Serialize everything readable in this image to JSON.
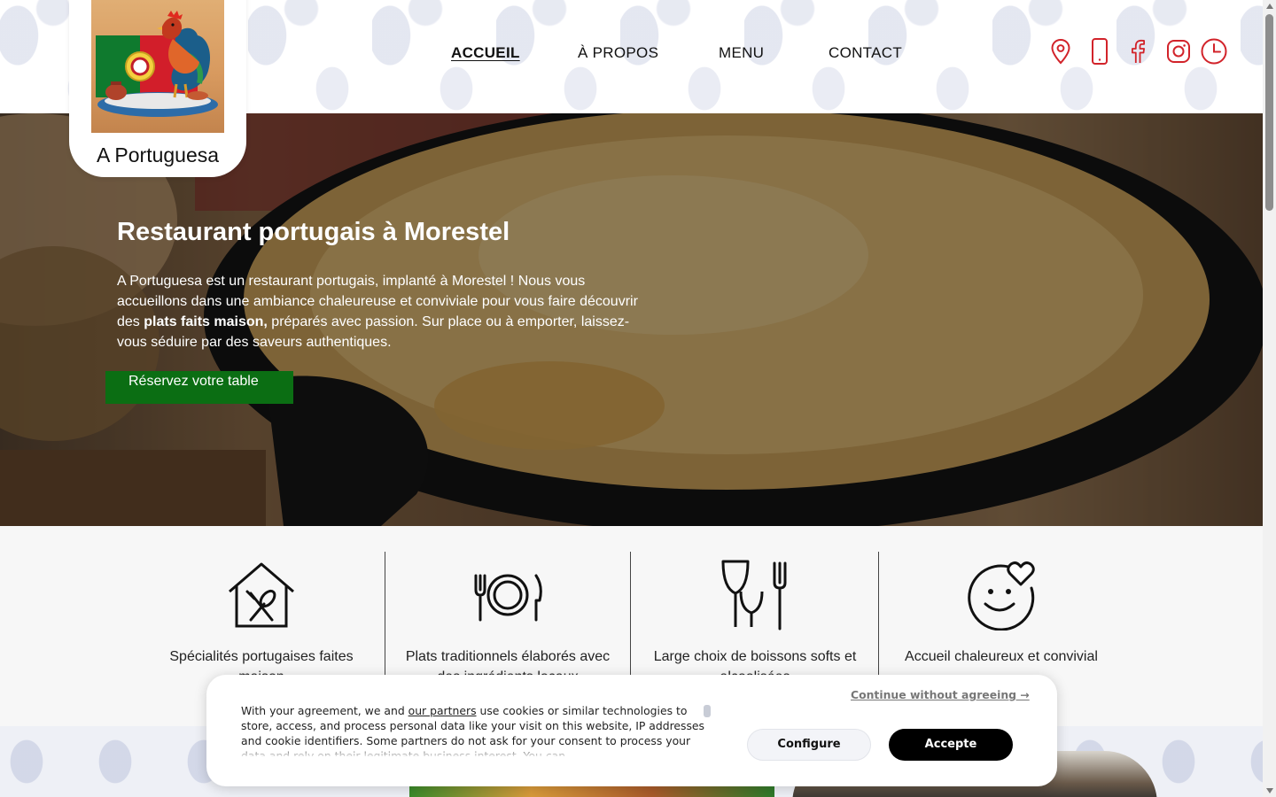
{
  "brand": {
    "name": "A Portuguesa"
  },
  "nav": [
    {
      "label": "ACCUEIL",
      "active": true
    },
    {
      "label": "À PROPOS",
      "active": false
    },
    {
      "label": "MENU",
      "active": false
    },
    {
      "label": "CONTACT",
      "active": false
    }
  ],
  "social_icons": [
    "map-pin-icon",
    "phone-icon",
    "facebook-icon",
    "instagram-icon",
    "clock-icon"
  ],
  "colors": {
    "accent_red": "#d2232a",
    "cta_green": "#0b6e13"
  },
  "hero": {
    "title": "Restaurant portugais à Morestel",
    "text_before": "A Portuguesa est un restaurant portugais, implanté à Morestel ! Nous vous accueillons dans une ambiance chaleureuse et conviviale pour vous faire découvrir des ",
    "text_bold": "plats faits maison,",
    "text_after": " préparés avec passion. Sur place ou à emporter, laissez-vous séduire par des saveurs authentiques.",
    "cta": "Réservez votre table"
  },
  "features": [
    {
      "icon": "house-cutlery-icon",
      "label": "Spécialités portugaises faites maison"
    },
    {
      "icon": "plate-cutlery-icon",
      "label": "Plats traditionnels élaborés avec des ingrédients locaux"
    },
    {
      "icon": "glasses-fork-icon",
      "label": "Large choix de boissons softs et alcoolisées"
    },
    {
      "icon": "smiley-heart-icon",
      "label": "Accueil chaleureux et convivial"
    }
  ],
  "cookie": {
    "continue": "Continue without agreeing →",
    "text_before": "With your agreement, we and ",
    "link": "our partners",
    "text_after": " use cookies or similar technologies to store, access, and process personal data like your visit on this website, IP addresses and cookie identifiers. Some partners do not ask for your consent to process your data and rely on their legitimate business interest. You can",
    "configure": "Configure",
    "accept": "Accepte"
  }
}
